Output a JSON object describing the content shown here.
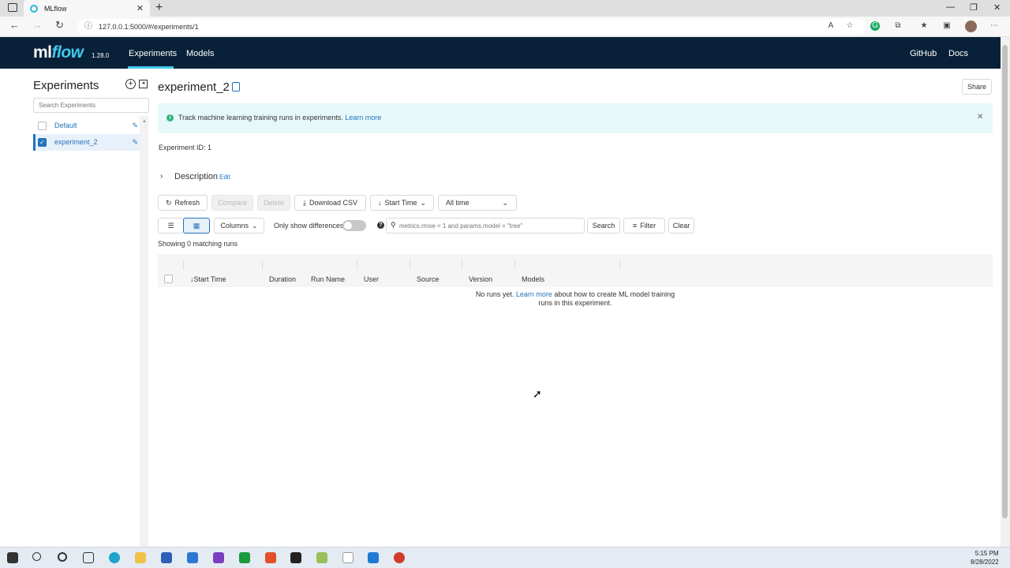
{
  "browser": {
    "tab_title": "MLflow",
    "url": "127.0.0.1:5000/#/experiments/1"
  },
  "header": {
    "logo_ml": "ml",
    "logo_flow": "flow",
    "version": "1.28.0",
    "nav": [
      "Experiments",
      "Models"
    ],
    "right": [
      "GitHub",
      "Docs"
    ]
  },
  "sidebar": {
    "title": "Experiments",
    "search_placeholder": "Search Experiments",
    "items": [
      {
        "label": "Default",
        "checked": false
      },
      {
        "label": "experiment_2",
        "checked": true
      }
    ]
  },
  "main": {
    "title": "experiment_2",
    "share_label": "Share",
    "banner_text": "Track machine learning training runs in experiments.",
    "banner_link": "Learn more",
    "experiment_id": "Experiment ID:  1",
    "description_label": "Description",
    "description_edit": "Edit",
    "toolbar": {
      "refresh": "Refresh",
      "compare": "Compare",
      "delete": "Delete",
      "download_csv": "Download CSV",
      "sort": "Start Time",
      "time_range": "All time",
      "columns": "Columns",
      "only_differences": "Only show differences",
      "search_placeholder": "metrics.rmse < 1 and params.model = \"tree\"",
      "search": "Search",
      "filter": "Filter",
      "clear": "Clear"
    },
    "showing": "Showing 0 matching runs",
    "columns": [
      "Start Time",
      "Duration",
      "Run Name",
      "User",
      "Source",
      "Version",
      "Models"
    ],
    "empty_prefix": "No runs yet.",
    "empty_link": "Learn more",
    "empty_suffix": "about how to create ML model training runs in this experiment."
  },
  "taskbar": {
    "time": "5:15 PM",
    "date": "8/28/2022"
  },
  "colors": {
    "header_bg": "#082138",
    "accent": "#43c9ed",
    "link": "#2374bb",
    "banner_bg": "#e7f8fb"
  }
}
